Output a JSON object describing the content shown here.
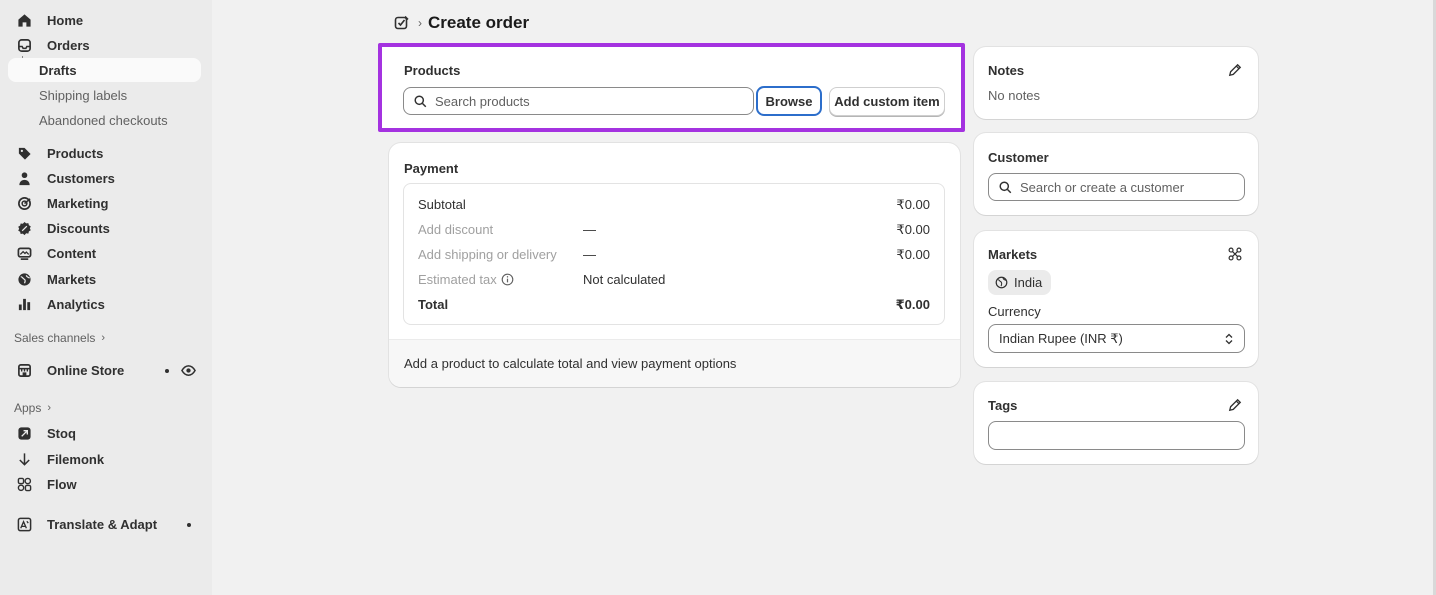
{
  "sidebar": {
    "items": [
      {
        "label": "Home",
        "icon": "home-icon"
      },
      {
        "label": "Orders",
        "icon": "orders-icon"
      },
      {
        "label": "Products",
        "icon": "tag-icon"
      },
      {
        "label": "Customers",
        "icon": "person-icon"
      },
      {
        "label": "Marketing",
        "icon": "target-icon"
      },
      {
        "label": "Discounts",
        "icon": "discount-icon"
      },
      {
        "label": "Content",
        "icon": "content-icon"
      },
      {
        "label": "Markets",
        "icon": "globe-icon"
      },
      {
        "label": "Analytics",
        "icon": "bar-chart-icon"
      }
    ],
    "order_subitems": [
      "Drafts",
      "Shipping labels",
      "Abandoned checkouts"
    ],
    "sales_channels_title": "Sales channels",
    "online_store_label": "Online Store",
    "apps_title": "Apps",
    "apps": [
      {
        "label": "Stoq",
        "icon": "stoq-icon"
      },
      {
        "label": "Filemonk",
        "icon": "filemonk-icon"
      },
      {
        "label": "Flow",
        "icon": "flow-icon"
      }
    ],
    "translate_label": "Translate & Adapt"
  },
  "header": {
    "title": "Create order"
  },
  "products_card": {
    "title": "Products",
    "search_placeholder": "Search products",
    "browse_label": "Browse",
    "add_custom_label": "Add custom item",
    "highlight_color": "#a432e0"
  },
  "payment_card": {
    "title": "Payment",
    "rows": {
      "subtotal": {
        "label": "Subtotal",
        "value": "₹0.00"
      },
      "discount": {
        "label": "Add discount",
        "mid": "—",
        "value": "₹0.00"
      },
      "shipping": {
        "label": "Add shipping or delivery",
        "mid": "—",
        "value": "₹0.00"
      },
      "tax": {
        "label": "Estimated tax",
        "mid": "Not calculated"
      },
      "total": {
        "label": "Total",
        "value": "₹0.00"
      }
    },
    "footer": "Add a product to calculate total and view payment options"
  },
  "notes_card": {
    "title": "Notes",
    "text": "No notes"
  },
  "customer_card": {
    "title": "Customer",
    "search_placeholder": "Search or create a customer"
  },
  "markets_card": {
    "title": "Markets",
    "market": "India",
    "currency_label": "Currency",
    "currency_value": "Indian Rupee (INR ₹)"
  },
  "tags_card": {
    "title": "Tags"
  }
}
